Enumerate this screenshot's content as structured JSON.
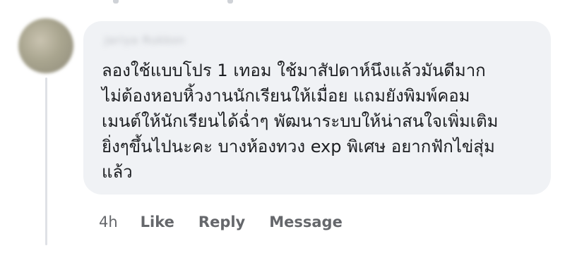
{
  "comment": {
    "author_name": "Jariya Rukkon",
    "text": "ลองใช้แบบโปร 1 เทอม ใช้มาสัปดาห์นึงแล้วมันดีมาก\nไม่ต้องหอบหิ้วงานนักเรียนให้เมื่อย แถมยังพิมพ์คอม\nเมนต์ให้นักเรียนได้ฉ่ำๆ พัฒนาระบบให้น่าสนใจเพิ่มเติม\nยิ่งๆขึ้นไปนะคะ บางห้องทวง exp พิเศษ อยากฟักไข่สุ่ม\nแล้ว",
    "timestamp": "4h",
    "actions": {
      "like": "Like",
      "reply": "Reply",
      "message": "Message"
    }
  }
}
